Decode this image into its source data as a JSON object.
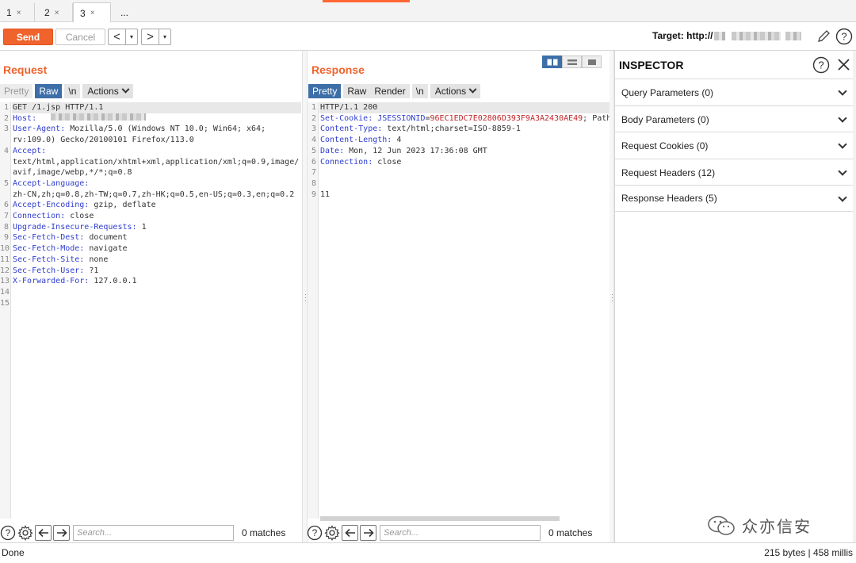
{
  "tabs": [
    {
      "label": "1",
      "close": "×"
    },
    {
      "label": "2",
      "close": "×"
    },
    {
      "label": "3",
      "close": "×"
    },
    {
      "label": "...",
      "close": ""
    }
  ],
  "toolbar": {
    "send_label": "Send",
    "cancel_label": "Cancel",
    "back_icon": "<",
    "forward_icon": ">",
    "dropdown_icon": "▾",
    "target_label": "Target: http://"
  },
  "request": {
    "title": "Request",
    "tabs": [
      "Pretty",
      "Raw",
      "\\n"
    ],
    "actions_label": "Actions",
    "line_numbers": [
      "1",
      "2",
      "3",
      "",
      "4",
      "",
      "",
      "5",
      "",
      "6",
      "7",
      "8",
      "9",
      "10",
      "11",
      "12",
      "13",
      "14",
      "15"
    ],
    "lines": [
      [
        {
          "t": "GET /1.jsp HTTP/1.1",
          "c": ""
        }
      ],
      [
        {
          "t": "Host:",
          "c": "k"
        },
        {
          "t": " ",
          "c": ""
        }
      ],
      [
        {
          "t": "User-Agent:",
          "c": "k"
        },
        {
          "t": " Mozilla/5.0 (Windows NT 10.0; Win64; x64;",
          "c": ""
        }
      ],
      [
        {
          "t": "rv:109.0) Gecko/20100101 Firefox/113.0",
          "c": ""
        }
      ],
      [
        {
          "t": "Accept:",
          "c": "k"
        }
      ],
      [
        {
          "t": "text/html,application/xhtml+xml,application/xml;q=0.9,image/",
          "c": ""
        }
      ],
      [
        {
          "t": "avif,image/webp,*/*;q=0.8",
          "c": ""
        }
      ],
      [
        {
          "t": "Accept-Language:",
          "c": "k"
        }
      ],
      [
        {
          "t": "zh-CN,zh;q=0.8,zh-TW;q=0.7,zh-HK;q=0.5,en-US;q=0.3,en;q=0.2",
          "c": ""
        }
      ],
      [
        {
          "t": "Accept-Encoding:",
          "c": "k"
        },
        {
          "t": " gzip, deflate",
          "c": ""
        }
      ],
      [
        {
          "t": "Connection:",
          "c": "k"
        },
        {
          "t": " close",
          "c": ""
        }
      ],
      [
        {
          "t": "Upgrade-Insecure-Requests:",
          "c": "k"
        },
        {
          "t": " 1",
          "c": ""
        }
      ],
      [
        {
          "t": "Sec-Fetch-Dest:",
          "c": "k"
        },
        {
          "t": " document",
          "c": ""
        }
      ],
      [
        {
          "t": "Sec-Fetch-Mode:",
          "c": "k"
        },
        {
          "t": " navigate",
          "c": ""
        }
      ],
      [
        {
          "t": "Sec-Fetch-Site:",
          "c": "k"
        },
        {
          "t": " none",
          "c": ""
        }
      ],
      [
        {
          "t": "Sec-Fetch-User:",
          "c": "k"
        },
        {
          "t": " ?1",
          "c": ""
        }
      ],
      [
        {
          "t": "X-Forwarded-For:",
          "c": "k"
        },
        {
          "t": " 127.0.0.1",
          "c": ""
        }
      ],
      [
        {
          "t": "",
          "c": ""
        }
      ],
      [
        {
          "t": "",
          "c": ""
        }
      ]
    ],
    "search_placeholder": "Search...",
    "matches": "0 matches"
  },
  "response": {
    "title": "Response",
    "tabs": [
      "Pretty",
      "Raw",
      "Render",
      "\\n"
    ],
    "actions_label": "Actions",
    "line_numbers": [
      "1",
      "2",
      "3",
      "4",
      "5",
      "6",
      "7",
      "8",
      "9"
    ],
    "lines": [
      [
        {
          "t": "HTTP/1.1 200",
          "c": ""
        }
      ],
      [
        {
          "t": "Set-Cookie:",
          "c": "k"
        },
        {
          "t": " ",
          "c": ""
        },
        {
          "t": "JSESSIONID",
          "c": "k"
        },
        {
          "t": "=",
          "c": ""
        },
        {
          "t": "96EC1EDC7E02806D393F9A3A2430AE49",
          "c": "c"
        },
        {
          "t": "; Path",
          "c": ""
        }
      ],
      [
        {
          "t": "Content-Type:",
          "c": "k"
        },
        {
          "t": " text/html;charset=ISO-8859-1",
          "c": ""
        }
      ],
      [
        {
          "t": "Content-Length:",
          "c": "k"
        },
        {
          "t": " 4",
          "c": ""
        }
      ],
      [
        {
          "t": "Date:",
          "c": "k"
        },
        {
          "t": " Mon, 12 Jun 2023 17:36:08 GMT",
          "c": ""
        }
      ],
      [
        {
          "t": "Connection:",
          "c": "k"
        },
        {
          "t": " close",
          "c": ""
        }
      ],
      [
        {
          "t": "",
          "c": ""
        }
      ],
      [
        {
          "t": "",
          "c": ""
        }
      ],
      [
        {
          "t": "11",
          "c": ""
        }
      ]
    ],
    "search_placeholder": "Search...",
    "matches": "0 matches"
  },
  "inspector": {
    "title": "INSPECTOR",
    "rows": [
      "Query Parameters (0)",
      "Body Parameters (0)",
      "Request Cookies (0)",
      "Request Headers (12)",
      "Response Headers (5)"
    ]
  },
  "status": {
    "left": "Done",
    "right": "215 bytes | 458 millis"
  },
  "watermark": "众亦信安",
  "colors": {
    "accent": "#f0632d",
    "selected": "#3d6ea8",
    "header_key": "#2f3dd0",
    "cookie_value": "#c0262a"
  }
}
